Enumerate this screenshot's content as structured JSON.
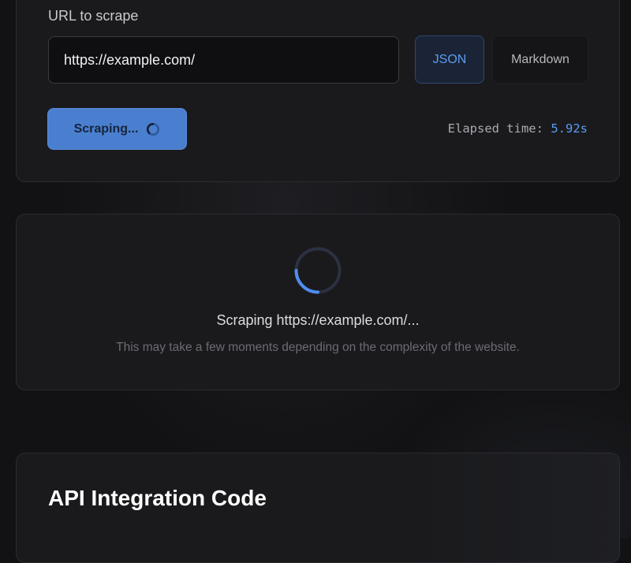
{
  "form": {
    "url_label": "URL to scrape",
    "url_value": "https://example.com/",
    "format_options": [
      "JSON",
      "Markdown"
    ],
    "selected_format": "JSON",
    "scrape_button_label": "Scraping...",
    "elapsed_label": "Elapsed time:",
    "elapsed_value": "5.92s"
  },
  "loading": {
    "title": "Scraping https://example.com/...",
    "subtitle": "This may take a few moments depending on the complexity of the website."
  },
  "api": {
    "title": "API Integration Code"
  },
  "colors": {
    "accent": "#5b9cf0",
    "button": "#4a7fd0",
    "background": "#121214",
    "card": "#1a1a1d"
  },
  "icons": {
    "button_spinner": "loading-spinner-icon",
    "main_spinner": "loading-spinner-icon"
  }
}
